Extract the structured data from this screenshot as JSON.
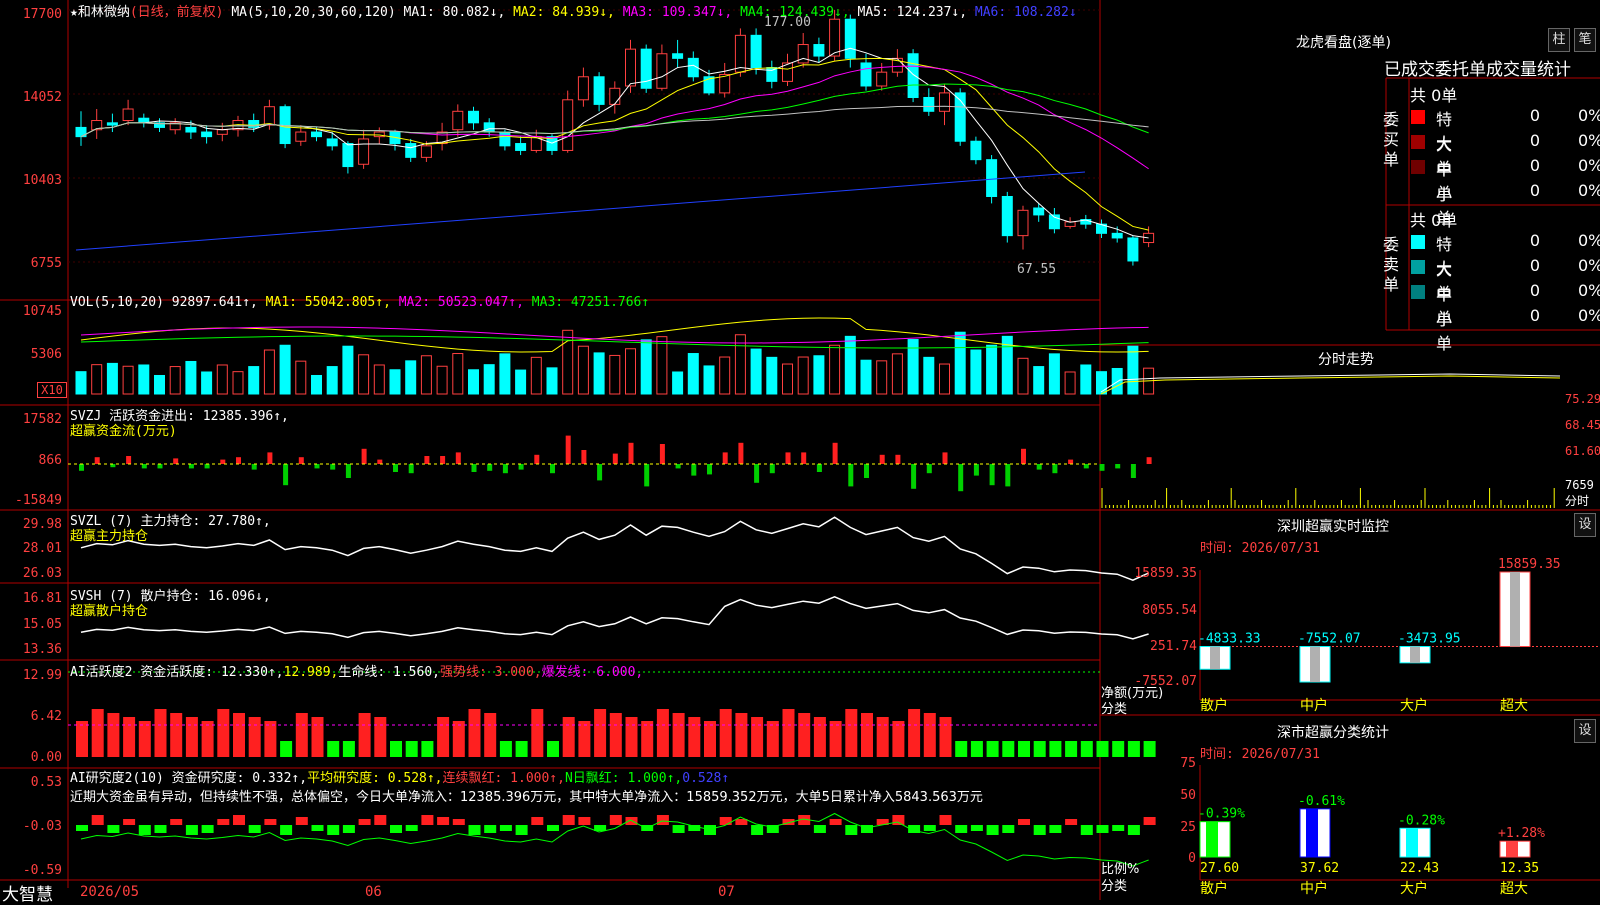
{
  "main_chart": {
    "star": "★",
    "stock_name": "和林微纳",
    "period": "(日线，前复权)",
    "ma_label": "MA(5,10,20,30,60,120)",
    "ma1": "MA1: 80.082↓,",
    "ma2": "MA2: 84.939↓,",
    "ma3": "MA3: 109.347↓,",
    "ma4": "MA4: 124.439↓,",
    "ma5": "MA5: 124.237↓,",
    "ma6": "MA6: 108.282↓",
    "y_ticks": [
      "17700",
      "14052",
      "10403",
      "6755"
    ],
    "high_label": "177.00",
    "low_label": "67.55"
  },
  "vol_panel": {
    "title": "VOL(5,10,20)",
    "value": "92897.641↑,",
    "ma1": "MA1: 55042.805↑,",
    "ma2": "MA2: 50523.047↑,",
    "ma3": "MA3: 47251.766↑",
    "y_ticks": [
      "10745",
      "5306"
    ],
    "unit": "X10"
  },
  "svzj_panel": {
    "title": "SVZJ  活跃资金进出: 12385.396↑,",
    "subtitle": "超赢资金流(万元)",
    "y_ticks": [
      "17582",
      "866",
      "-15849"
    ]
  },
  "svzl_panel": {
    "title": "SVZL (7) 主力持仓: 27.780↑,",
    "subtitle": "超赢主力持仓",
    "y_ticks": [
      "29.98",
      "28.01",
      "26.03"
    ]
  },
  "svsh_panel": {
    "title": "SVSH (7) 散户持仓: 16.096↓,",
    "subtitle": "超赢散户持仓",
    "y_ticks": [
      "16.81",
      "15.05",
      "13.36"
    ]
  },
  "ai2_panel": {
    "t1": "AI活跃度2 资金活跃度: 12.330↑,",
    "t2": "12.989,",
    "t3": "生命线: 1.560,",
    "t4": "强势线: 3.000,",
    "t5": "爆发线: 6.000,",
    "y_ticks": [
      "12.99",
      "6.42",
      "0.00"
    ]
  },
  "ai_research": {
    "t1": "AI研究度2(10) 资金研究度: 0.332↑,",
    "t2": "平均研究度: 0.528↑,",
    "t3": "连续飘红: 1.000↑,",
    "t4": "N日飘红: 1.000↑,",
    "t5": "0.528↑",
    "comment": "近期大资金虽有异动，但持续性不强，总体偏空，今日大单净流入：12385.396万元，其中特大单净流入：15859.352万元，大单5日累计净入5843.563万元",
    "y_ticks": [
      "0.53",
      "-0.03",
      "-0.59"
    ]
  },
  "footer": {
    "brand": "大智慧",
    "dates": [
      "2026/05",
      "06",
      "07"
    ]
  },
  "dragon_tiger": {
    "title": "龙虎看盘(逐单)",
    "btn_column": "柱",
    "btn_pen": "笔",
    "header": "已成交委托单成交量统计",
    "buy_label": "委买单",
    "sell_label": "委卖单",
    "buy_total": "共 0单",
    "sell_total": "共 0单",
    "buy_rows": [
      {
        "name": "特大",
        "count": "0",
        "pct": "0%",
        "color": "#ff0000"
      },
      {
        "name": "大单",
        "count": "0",
        "pct": "0%",
        "color": "#a00000"
      },
      {
        "name": "中单",
        "count": "0",
        "pct": "0%",
        "color": "#700000"
      },
      {
        "name": "小单",
        "count": "0",
        "pct": "0%",
        "color": "#000000"
      }
    ],
    "sell_rows": [
      {
        "name": "特大",
        "count": "0",
        "pct": "0%",
        "color": "#00ffff"
      },
      {
        "name": "大单",
        "count": "0",
        "pct": "0%",
        "color": "#00a0a0"
      },
      {
        "name": "中单",
        "count": "0",
        "pct": "0%",
        "color": "#008080"
      },
      {
        "name": "小单",
        "count": "0",
        "pct": "0%",
        "color": "#000000"
      }
    ]
  },
  "intraday": {
    "title": "分时走势",
    "y_ticks": [
      "75.29",
      "68.45",
      "61.60"
    ],
    "vol_tick": "7659",
    "unit": "分时"
  },
  "sz_monitor": {
    "title": "深圳超赢实时监控",
    "btn": "设",
    "time_label": "时间: 2026/07/31",
    "y_ticks": [
      "15859.35",
      "8055.54",
      "251.74",
      "-7552.07"
    ],
    "axis_title": "净额(万元)",
    "axis_sub": "分类",
    "bars": [
      {
        "cat": "散户",
        "value": "-4833.33",
        "color": "#00ffff"
      },
      {
        "cat": "中户",
        "value": "-7552.07",
        "color": "#00ffff"
      },
      {
        "cat": "大户",
        "value": "-3473.95",
        "color": "#00ffff"
      },
      {
        "cat": "超大",
        "value": "15859.35",
        "color": "#ff4040"
      }
    ]
  },
  "sz_stats": {
    "title": "深市超赢分类统计",
    "btn": "设",
    "time_label": "时间: 2026/07/31",
    "y_ticks": [
      "75",
      "50",
      "25",
      "0"
    ],
    "axis_title": "比例%",
    "axis_sub": "分类",
    "bars": [
      {
        "cat": "散户",
        "value": "27.60",
        "change": "-0.39%",
        "fill": "#00ff00"
      },
      {
        "cat": "中户",
        "value": "37.62",
        "change": "-0.61%",
        "fill": "#0000ff"
      },
      {
        "cat": "大户",
        "value": "22.43",
        "change": "-0.28%",
        "fill": "#00ffff"
      },
      {
        "cat": "超大",
        "value": "12.35",
        "change": "+1.28%",
        "fill": "#ff4040"
      }
    ]
  },
  "chart_data": {
    "type": "candlestick",
    "ylim": [
      6755,
      17700
    ],
    "candles": [
      [
        12.6,
        12.2,
        13.3,
        11.8
      ],
      [
        12.5,
        12.9,
        13.4,
        12.1
      ],
      [
        12.8,
        12.7,
        13.2,
        12.4
      ],
      [
        12.9,
        13.4,
        13.8,
        12.7
      ],
      [
        13.0,
        12.8,
        13.2,
        12.6
      ],
      [
        12.8,
        12.6,
        13.0,
        12.4
      ],
      [
        12.5,
        12.8,
        13.0,
        12.3
      ],
      [
        12.6,
        12.4,
        12.9,
        12.1
      ],
      [
        12.4,
        12.2,
        12.7,
        11.9
      ],
      [
        12.3,
        12.5,
        12.8,
        12.0
      ],
      [
        12.5,
        12.9,
        13.1,
        12.2
      ],
      [
        12.9,
        12.6,
        13.2,
        12.4
      ],
      [
        12.7,
        13.5,
        13.8,
        12.5
      ],
      [
        13.5,
        11.9,
        13.6,
        11.7
      ],
      [
        12.0,
        12.4,
        12.7,
        11.8
      ],
      [
        12.4,
        12.2,
        12.6,
        12.0
      ],
      [
        12.1,
        11.8,
        12.4,
        11.6
      ],
      [
        11.9,
        10.9,
        12.0,
        10.6
      ],
      [
        11.0,
        12.1,
        12.5,
        10.8
      ],
      [
        12.2,
        12.4,
        12.6,
        11.9
      ],
      [
        12.4,
        11.9,
        12.5,
        11.6
      ],
      [
        11.9,
        11.3,
        12.1,
        11.1
      ],
      [
        11.3,
        11.8,
        12.0,
        11.1
      ],
      [
        11.9,
        12.4,
        12.8,
        11.6
      ],
      [
        12.5,
        13.3,
        13.6,
        12.2
      ],
      [
        13.3,
        12.8,
        13.5,
        12.5
      ],
      [
        12.8,
        12.4,
        13.0,
        12.2
      ],
      [
        12.4,
        11.8,
        12.5,
        11.6
      ],
      [
        11.9,
        11.6,
        12.2,
        11.4
      ],
      [
        11.6,
        12.2,
        12.5,
        11.5
      ],
      [
        12.2,
        11.6,
        12.3,
        11.4
      ],
      [
        11.6,
        13.8,
        14.2,
        11.5
      ],
      [
        13.8,
        14.8,
        15.2,
        13.5
      ],
      [
        14.8,
        13.6,
        15.0,
        13.3
      ],
      [
        13.6,
        14.3,
        14.6,
        13.2
      ],
      [
        14.4,
        16.0,
        16.4,
        14.1
      ],
      [
        16.0,
        14.3,
        16.2,
        14.1
      ],
      [
        14.3,
        15.8,
        16.2,
        14.2
      ],
      [
        15.8,
        15.6,
        16.4,
        15.2
      ],
      [
        15.6,
        14.8,
        15.9,
        14.6
      ],
      [
        14.8,
        14.1,
        15.1,
        14.0
      ],
      [
        14.1,
        14.9,
        15.4,
        13.9
      ],
      [
        15.0,
        16.6,
        16.9,
        14.8
      ],
      [
        16.6,
        15.2,
        16.9,
        14.9
      ],
      [
        15.2,
        14.6,
        15.5,
        14.3
      ],
      [
        14.6,
        15.4,
        15.8,
        14.4
      ],
      [
        15.4,
        16.2,
        16.7,
        15.2
      ],
      [
        16.2,
        15.7,
        16.5,
        15.4
      ],
      [
        15.7,
        17.3,
        17.7,
        15.5
      ],
      [
        17.3,
        15.6,
        17.5,
        15.2
      ],
      [
        15.4,
        14.4,
        15.8,
        14.2
      ],
      [
        14.4,
        15.0,
        15.4,
        14.2
      ],
      [
        15.0,
        15.6,
        16.0,
        14.8
      ],
      [
        15.8,
        13.9,
        16.0,
        13.7
      ],
      [
        13.9,
        13.3,
        14.3,
        13.1
      ],
      [
        13.3,
        14.1,
        14.5,
        12.7
      ],
      [
        14.1,
        12.0,
        14.3,
        11.8
      ],
      [
        12.0,
        11.2,
        12.2,
        11.0
      ],
      [
        11.2,
        9.6,
        11.4,
        9.3
      ],
      [
        9.6,
        7.9,
        9.8,
        7.6
      ],
      [
        7.9,
        9.0,
        9.2,
        7.3
      ],
      [
        9.1,
        8.8,
        9.3,
        8.5
      ],
      [
        8.8,
        8.2,
        9.1,
        8.0
      ],
      [
        8.3,
        8.5,
        8.7,
        8.2
      ],
      [
        8.6,
        8.4,
        8.8,
        8.2
      ],
      [
        8.4,
        8.0,
        8.6,
        7.8
      ],
      [
        8.0,
        7.8,
        8.3,
        7.6
      ],
      [
        7.8,
        6.8,
        7.9,
        6.6
      ],
      [
        7.6,
        8.0,
        8.3,
        7.4
      ]
    ],
    "scale_note": "prices in hundreds of y-axis units"
  }
}
